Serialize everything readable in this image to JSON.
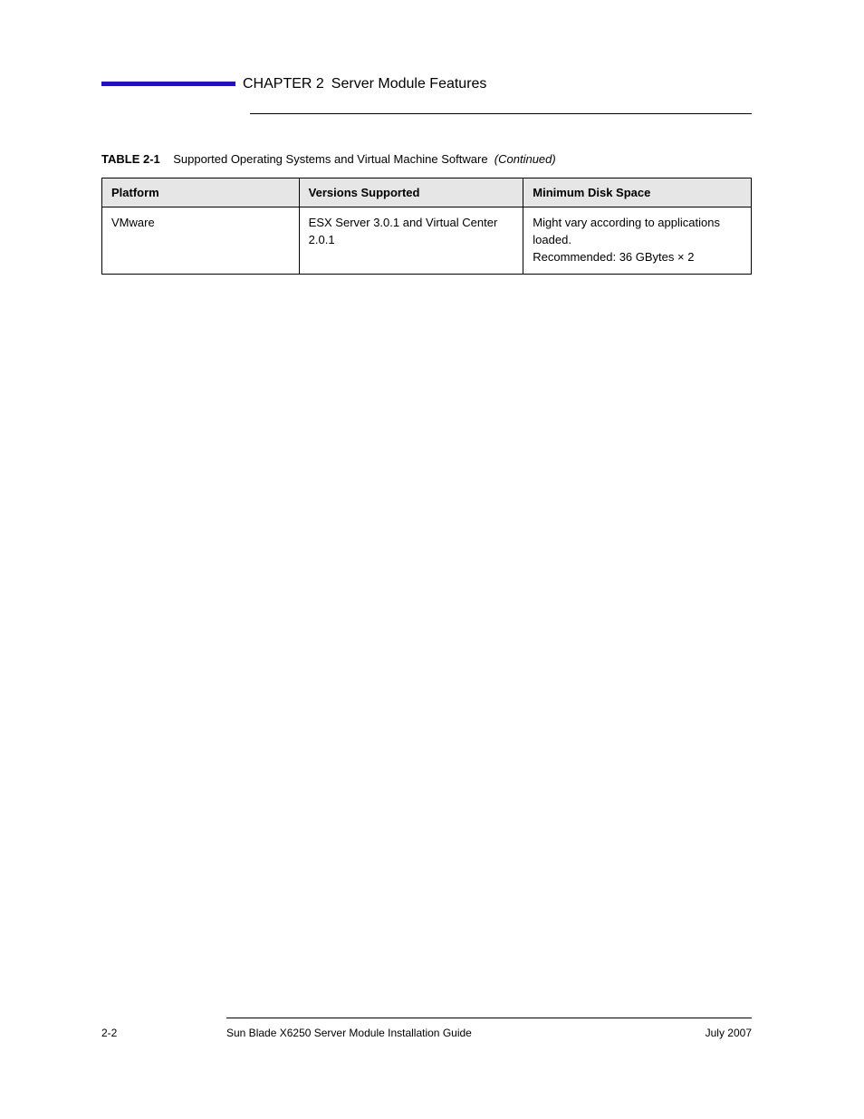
{
  "header": {
    "kicker": "CHAPTER 2",
    "title": "Server Module Features"
  },
  "table": {
    "label": "TABLE 2-1",
    "caption_rest": "Supported Operating Systems and Virtual Machine Software",
    "continued": "(Continued)",
    "headers": [
      "Platform",
      "Versions Supported",
      "Minimum Disk Space"
    ],
    "row": {
      "platform": "VMware",
      "versions": "ESX Server 3.0.1 and Virtual Center 2.0.1",
      "disk_line1": "Might vary according to applications loaded.",
      "disk_line2_pre": "Recommended:",
      "disk_line2_val": "36 GBytes × 2"
    }
  },
  "footer": {
    "page_number": "2-2",
    "doc_title": "Sun Blade X6250 Server Module Installation Guide",
    "doc_date": "July 2007"
  }
}
